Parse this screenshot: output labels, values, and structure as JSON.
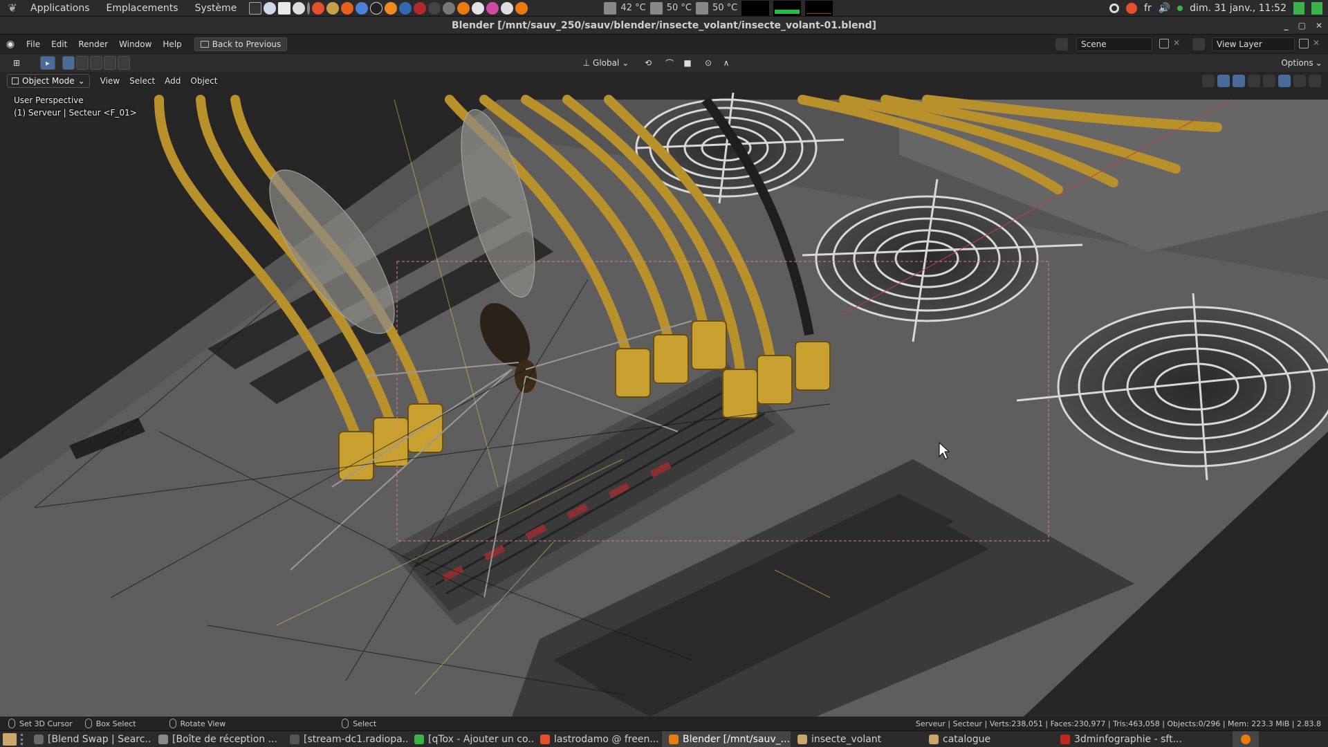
{
  "system_panel": {
    "menus": [
      "Applications",
      "Emplacements",
      "Système"
    ],
    "sensors": [
      {
        "icon": "cpu-temp-icon",
        "value": "42 °C"
      },
      {
        "icon": "gpu-temp-icon",
        "value": "50 °C"
      },
      {
        "icon": "disk-temp-icon",
        "value": "50 °C"
      }
    ],
    "keyboard_layout": "fr",
    "clock": "dim. 31 janv., 11:52"
  },
  "window": {
    "title": "Blender [/mnt/sauv_250/sauv/blender/insecte_volant/insecte_volant-01.blend]",
    "controls": [
      "_",
      "▢",
      "✕"
    ]
  },
  "topbar": {
    "menus": [
      "File",
      "Edit",
      "Render",
      "Window",
      "Help"
    ],
    "back_button": "Back to Previous",
    "scene": "Scene",
    "view_layer": "View Layer"
  },
  "toolbar": {
    "transform_orientation": "Global",
    "options_label": "Options"
  },
  "viewport": {
    "mode": "Object Mode",
    "menus": [
      "View",
      "Select",
      "Add",
      "Object"
    ],
    "perspective_label": "User Perspective",
    "active_object_label": "(1) Serveur | Secteur <F_01>"
  },
  "statusbar": {
    "items": [
      {
        "icon": "mouse-left-icon",
        "label": "Set 3D Cursor"
      },
      {
        "icon": "mouse-drag-icon",
        "label": "Box Select"
      },
      {
        "icon": "mouse-middle-icon",
        "label": "Rotate View"
      },
      {
        "icon": "mouse-right-icon",
        "label": "Select"
      }
    ],
    "stats": "Serveur | Secteur | Verts:238,051 | Faces:230,977 | Tris:463,058 | Objects:0/296 | Mem: 223.3 MiB | 2.83.8"
  },
  "taskbar": {
    "tasks": [
      {
        "label": "[Blend Swap | Searc...",
        "color": "#6a6a6a",
        "active": false
      },
      {
        "label": "[Boîte de réception ...",
        "color": "#8a8a8a",
        "active": false
      },
      {
        "label": "[stream-dc1.radiopa...",
        "color": "#555555",
        "active": false
      },
      {
        "label": "[qTox - Ajouter un co...",
        "color": "#3bb34a",
        "active": false
      },
      {
        "label": "lastrodamo @ freen...",
        "color": "#e4502a",
        "active": false
      },
      {
        "label": "Blender [/mnt/sauv_...",
        "color": "#e87d0d",
        "active": true
      },
      {
        "label": "insecte_volant",
        "color": "#c9a86a",
        "active": false
      },
      {
        "label": "catalogue",
        "color": "#c9a86a",
        "active": false
      },
      {
        "label": "3dminfographie - sft...",
        "color": "#c0281c",
        "active": false
      }
    ]
  },
  "colors": {
    "cable": "#b8912a",
    "selection_box": "#e08090",
    "accent": "#4a6c9a"
  }
}
